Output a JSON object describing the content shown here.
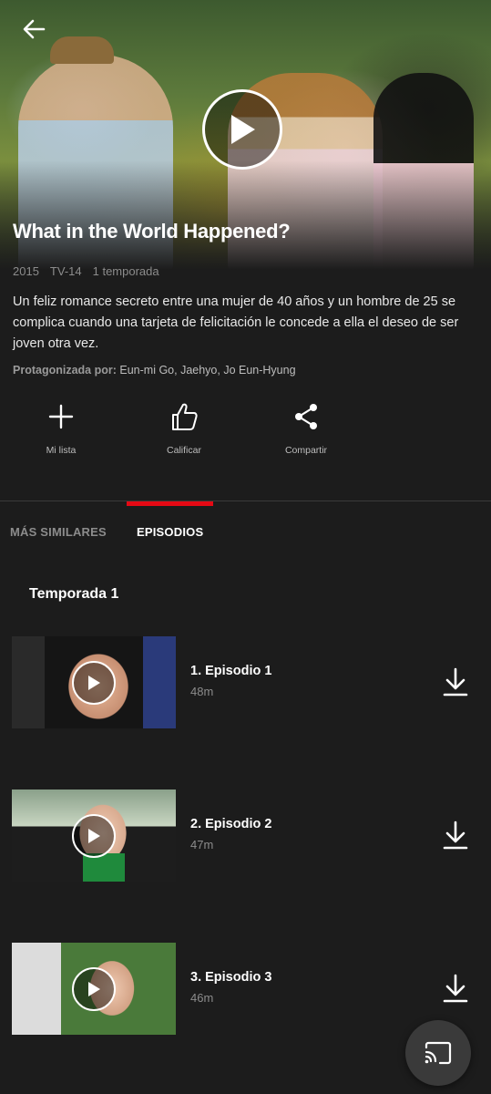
{
  "show": {
    "title": "What in the World Happened?",
    "year": "2015",
    "rating": "TV-14",
    "seasons": "1 temporada",
    "description": "Un feliz romance secreto entre una mujer de 40 años y un hombre de 25 se complica cuando una tarjeta de felicitación le concede a ella el deseo de ser joven otra vez.",
    "cast_label": "Protagonizada por:",
    "cast": "Eun-mi Go, Jaehyo, Jo Eun-Hyung"
  },
  "actions": [
    {
      "label": "Mi lista",
      "icon": "plus-icon"
    },
    {
      "label": "Calificar",
      "icon": "thumbs-up-icon"
    },
    {
      "label": "Compartir",
      "icon": "share-icon"
    }
  ],
  "tabs": [
    {
      "label": "MÁS SIMILARES",
      "active": false
    },
    {
      "label": "EPISODIOS",
      "active": true
    }
  ],
  "season_selector": "Temporada 1",
  "episodes": [
    {
      "title": "1. Episodio 1",
      "duration": "48m"
    },
    {
      "title": "2. Episodio 2",
      "duration": "47m"
    },
    {
      "title": "3. Episodio 3",
      "duration": "46m"
    }
  ],
  "colors": {
    "background": "#1c1c1c",
    "accent": "#e50914",
    "muted_text": "#8c8c8c"
  },
  "icons": {
    "back": "arrow-left-icon",
    "play": "play-icon",
    "download": "download-icon",
    "cast": "cast-icon"
  }
}
